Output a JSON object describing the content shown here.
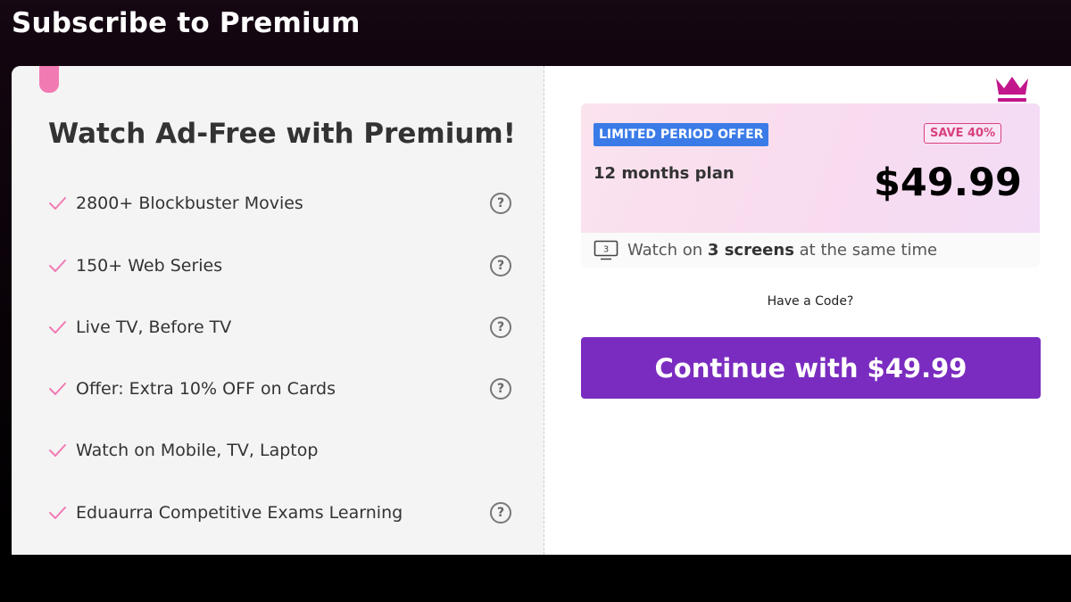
{
  "header": {
    "title": "Subscribe to Premium"
  },
  "features": {
    "heading": "Watch Ad-Free with Premium!",
    "items": [
      {
        "label": "2800+ Blockbuster Movies",
        "help": "?"
      },
      {
        "label": "150+ Web Series",
        "help": "?"
      },
      {
        "label": "Live TV, Before TV",
        "help": "?"
      },
      {
        "label": "Offer: Extra 10% OFF on Cards",
        "help": "?"
      },
      {
        "label": "Watch on Mobile, TV, Laptop"
      },
      {
        "label": "Eduaurra Competitive Exams Learning",
        "help": "?"
      }
    ]
  },
  "plan": {
    "offer_badge": "LIMITED PERIOD OFFER",
    "save_badge": "SAVE 40%",
    "name": "12 months plan",
    "price": "$49.99",
    "screens_icon_number": "3",
    "screens_prefix": "Watch on",
    "screens_bold": "3 screens",
    "screens_suffix": "at the same time"
  },
  "code_link": "Have a Code?",
  "continue_button": "Continue with $49.99",
  "colors": {
    "accent": "#7b2cc0",
    "check": "#f17ab3",
    "offer_badge": "#3b7be8",
    "save_badge": "#d9417e",
    "crown": "#c2168c"
  },
  "icons": {
    "crown": "crown-icon",
    "check": "check-icon",
    "help": "help-icon",
    "tv": "tv-icon"
  }
}
